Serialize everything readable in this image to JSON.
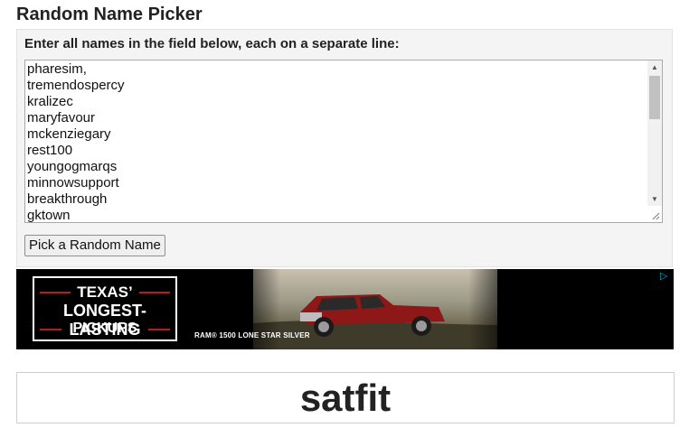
{
  "header": {
    "title": "Random Name Picker"
  },
  "form": {
    "instruction": "Enter all names in the field below, each on a separate line:",
    "names": [
      "pharesim,",
      "tremendospercy",
      "kralizec",
      "maryfavour",
      "mckenziegary",
      "rest100",
      "youngogmarqs",
      "minnowsupport",
      "breakthrough",
      "gktown"
    ],
    "button_label": "Pick a Random Name"
  },
  "ad": {
    "headline": [
      "TEXAS’",
      "LONGEST-LASTING",
      "PICKUPS"
    ],
    "model": "RAM® 1500 LONE STAR SILVER",
    "adchoices_icon": "adchoices-icon",
    "accent": "#b71c1c"
  },
  "result": {
    "picked_name": "satfit"
  },
  "colors": {
    "panel_bg": "#f4f4f4",
    "text": "#222222",
    "adchoices": "#00aecd"
  }
}
